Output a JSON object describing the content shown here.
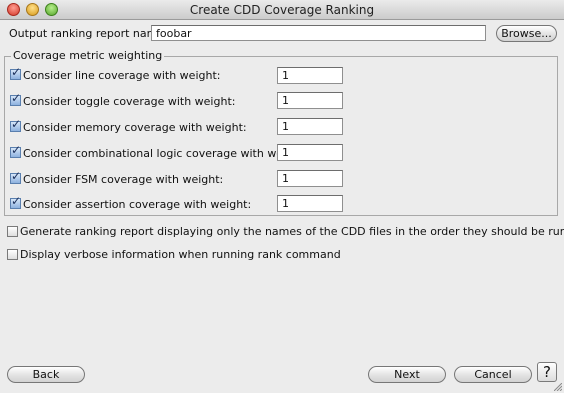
{
  "window": {
    "title": "Create CDD Coverage Ranking"
  },
  "output": {
    "label": "Output ranking report name:",
    "value": "foobar",
    "browse_label": "Browse..."
  },
  "weighting": {
    "legend": "Coverage metric weighting",
    "rows": [
      {
        "label": "Consider line coverage with weight:",
        "checked": true,
        "weight": "1"
      },
      {
        "label": "Consider toggle coverage with weight:",
        "checked": true,
        "weight": "1"
      },
      {
        "label": "Consider memory coverage with weight:",
        "checked": true,
        "weight": "1"
      },
      {
        "label": "Consider combinational logic coverage with weight:",
        "checked": true,
        "weight": "1"
      },
      {
        "label": "Consider FSM coverage with weight:",
        "checked": true,
        "weight": "1"
      },
      {
        "label": "Consider assertion coverage with weight:",
        "checked": true,
        "weight": "1"
      }
    ]
  },
  "options": [
    {
      "label": "Generate ranking report displaying only the names of the CDD files in the order they should be run",
      "checked": false
    },
    {
      "label": "Display verbose information when running rank command",
      "checked": false
    }
  ],
  "footer": {
    "back_label": "Back",
    "next_label": "Next",
    "cancel_label": "Cancel",
    "help_label": "?"
  }
}
